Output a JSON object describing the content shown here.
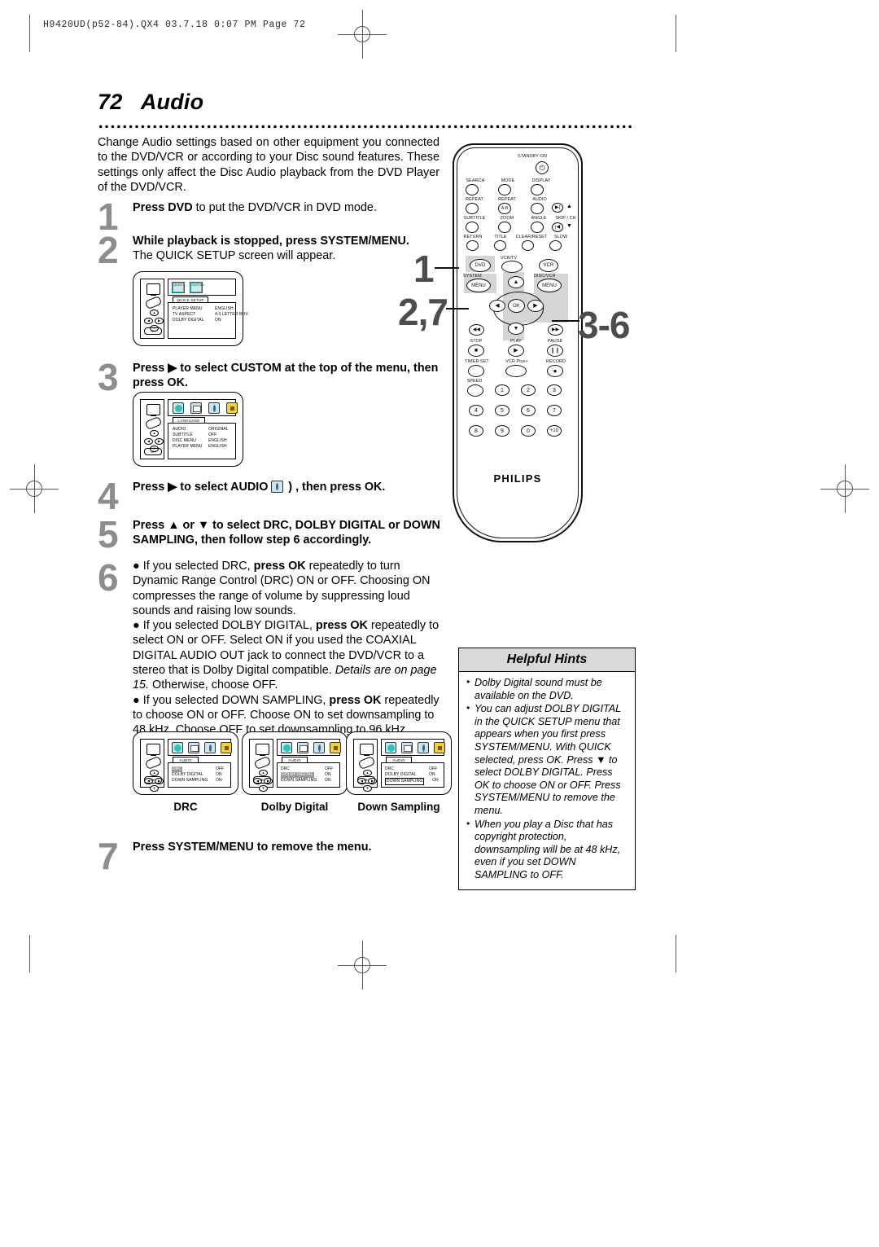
{
  "page_header": {
    "filename": "H9420UD(p52-84).QX4  03.7.18  0:07 PM  Page 72"
  },
  "title": {
    "number": "72",
    "text": "Audio"
  },
  "intro": "Change Audio settings based on other equipment you connected to the DVD/VCR or according to your Disc sound features. These settings only affect the Disc Audio playback from the DVD Player of the DVD/VCR.",
  "steps": [
    {
      "num": "1",
      "html": "<b>Press DVD</b> to put the DVD/VCR in DVD mode."
    },
    {
      "num": "2",
      "html": "<b>While playback is stopped, press SYSTEM/MENU.</b><br>The QUICK SETUP screen will appear."
    },
    {
      "num": "3",
      "html": "<b>Press ▶ to select CUSTOM at the top of the menu, then press OK.</b>"
    },
    {
      "num": "4",
      "html": "<b>Press ▶ to select AUDIO (&nbsp;&nbsp;&nbsp;&nbsp;) , then press OK.</b>"
    },
    {
      "num": "5",
      "html": "<b>Press ▲ or ▼ to select DRC, DOLBY DIGITAL or DOWN SAMPLING, then follow step 6 accordingly.</b>"
    },
    {
      "num": "6",
      "html": "● If you selected DRC, <b>press OK</b> repeatedly to turn Dynamic Range Control (DRC) ON or OFF. Choosing ON compresses the range of volume by suppressing loud sounds and raising low sounds.<br>● If you selected DOLBY DIGITAL, <b>press OK</b> repeatedly to select ON or OFF. Select ON if you used the COAXIAL DIGITAL AUDIO OUT jack to connect the DVD/VCR to a stereo that is Dolby Digital compatible. <i>Details are on page 15.</i> Otherwise, choose OFF.<br>● If you selected DOWN SAMPLING, <b>press OK</b> repeatedly to choose ON or OFF. Choose ON to set downsampling to 48 kHz. Choose OFF to set downsampling to 96 kHz."
    },
    {
      "num": "7",
      "html": "<b>Press SYSTEM/MENU to remove the menu.</b>"
    }
  ],
  "screens": {
    "quick_setup": {
      "tab": "QUICK SETUP",
      "tiles": [
        "QUICK",
        "CUSTOM"
      ],
      "rows": [
        {
          "label": "PLAYER MENU",
          "value": "ENGLISH"
        },
        {
          "label": "TV ASPECT",
          "value": "4:3 LETTER BOX"
        },
        {
          "label": "DOLBY DIGITAL",
          "value": "ON"
        }
      ]
    },
    "language": {
      "tab": "LANGUAGE",
      "icons": [
        "globe-icon",
        "display-icon",
        "audio-icon",
        "lock-icon"
      ],
      "rows": [
        {
          "label": "AUDIO",
          "value": "ORIGINAL"
        },
        {
          "label": "SUBTITLE",
          "value": "OFF"
        },
        {
          "label": "DISC MENU",
          "value": "ENGLISH"
        },
        {
          "label": "PLAYER MENU",
          "value": "ENGLISH"
        }
      ]
    },
    "audio_screens": [
      {
        "caption": "DRC",
        "tab": "AUDIO",
        "rows": [
          {
            "label": "DRC",
            "value": "OFF",
            "highlight": "fill"
          },
          {
            "label": "DOLBY DIGITAL",
            "value": "ON",
            "highlight": "none"
          },
          {
            "label": "DOWN SAMPLING",
            "value": "ON",
            "highlight": "none"
          }
        ]
      },
      {
        "caption": "Dolby Digital",
        "tab": "AUDIO",
        "rows": [
          {
            "label": "DRC",
            "value": "OFF",
            "highlight": "none"
          },
          {
            "label": "DOLBY DIGITAL",
            "value": "ON",
            "highlight": "fill"
          },
          {
            "label": "DOWN SAMPLING",
            "value": "ON",
            "highlight": "none"
          }
        ]
      },
      {
        "caption": "Down Sampling",
        "tab": "AUDIO",
        "rows": [
          {
            "label": "DRC",
            "value": "OFF",
            "highlight": "none"
          },
          {
            "label": "DOLBY DIGITAL",
            "value": "ON",
            "highlight": "none"
          },
          {
            "label": "DOWN SAMPLING",
            "value": "ON",
            "highlight": "box"
          }
        ]
      }
    ]
  },
  "remote": {
    "brand": "PHILIPS",
    "standby_label": "STANDBY·ON",
    "labels_row1": [
      "SEARCH",
      "MODE",
      "DISPLAY"
    ],
    "labels_row2": [
      "REPEAT",
      "REPEAT",
      "AUDIO"
    ],
    "labels_row3": [
      "SUBTITLE",
      "ZOOM",
      "ANGLE",
      "SKIP / CH"
    ],
    "labels_row4": [
      "RETURN",
      "TITLE",
      "CLEAR/RESET",
      "SLOW"
    ],
    "ab_label": "A-B",
    "dvd_label": "DVD",
    "vcrtv_label": "VCR/TV",
    "vcr_label": "VCR",
    "system_label": "SYSTEM",
    "discvcr_label": "DISC/VCR",
    "menu_label": "MENU",
    "ok_label": "OK",
    "transport_labels": [
      "STOP",
      "PLAY",
      "PAUSE"
    ],
    "labels_row5": [
      "TIMER SET",
      "VCR Plus+",
      "RECORD"
    ],
    "speed_label": "SPEED",
    "numpad": [
      "1",
      "2",
      "3",
      "4",
      "5",
      "6",
      "7",
      "8",
      "9",
      "0",
      "+10"
    ]
  },
  "callouts": [
    {
      "text": "1"
    },
    {
      "text": "2,7"
    },
    {
      "text": "3-6"
    }
  ],
  "hints": {
    "heading": "Helpful Hints",
    "items": [
      "Dolby Digital sound must be available on the DVD.",
      "You can adjust DOLBY DIGITAL in the QUICK SETUP menu that appears when you first press SYSTEM/MENU. With QUICK selected, press OK. Press ▼ to select DOLBY DIGITAL. Press OK to choose ON or OFF. Press SYSTEM/MENU to remove the menu.",
      "When you play a Disc that has copyright protection, downsampling will be at 48 kHz, even if you set DOWN SAMPLING to OFF."
    ]
  }
}
